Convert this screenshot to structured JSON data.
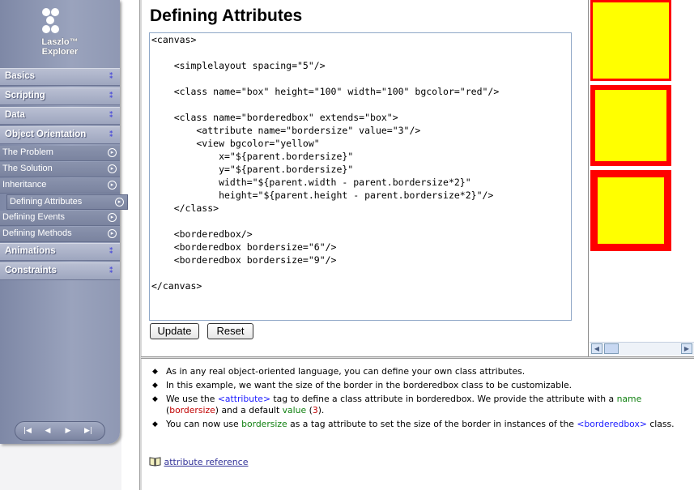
{
  "logo": {
    "line1": "Laszlo™",
    "line2": "Explorer"
  },
  "nav": {
    "main_items": [
      {
        "label": "Basics"
      },
      {
        "label": "Scripting"
      },
      {
        "label": "Data"
      },
      {
        "label": "Object Orientation"
      }
    ],
    "sub_items": [
      {
        "label": "The Problem"
      },
      {
        "label": "The Solution"
      },
      {
        "label": "Inheritance"
      },
      {
        "label": "Defining Attributes"
      },
      {
        "label": "Defining Events"
      },
      {
        "label": "Defining Methods"
      }
    ],
    "bottom_items": [
      {
        "label": "Animations"
      },
      {
        "label": "Constraints"
      }
    ],
    "active_item": "Defining Attributes",
    "player_buttons": [
      "first-icon",
      "prev-icon",
      "next-icon",
      "last-icon"
    ]
  },
  "page": {
    "title": "Defining Attributes"
  },
  "code": "<canvas>\n\n    <simplelayout spacing=\"5\"/>\n\n    <class name=\"box\" height=\"100\" width=\"100\" bgcolor=\"red\"/>\n\n    <class name=\"borderedbox\" extends=\"box\">\n        <attribute name=\"bordersize\" value=\"3\"/>\n        <view bgcolor=\"yellow\"\n            x=\"${parent.bordersize}\"\n            y=\"${parent.bordersize}\"\n            width=\"${parent.width - parent.bordersize*2}\"\n            height=\"${parent.height - parent.bordersize*2}\"/>\n    </class>\n\n    <borderedbox/>\n    <borderedbox bordersize=\"6\"/>\n    <borderedbox bordersize=\"9\"/>\n\n</canvas>",
  "buttons": {
    "update": "Update",
    "reset": "Reset"
  },
  "preview": {
    "border_sizes": [
      3,
      6,
      9
    ],
    "outer_color": "#ff0000",
    "inner_color": "#ffff00"
  },
  "notes": {
    "n1": "As in any real object-oriented language, you can define your own class attributes.",
    "n2": "In this example, we want the size of the border in the borderedbox class to be customizable.",
    "n3_a": "We use the ",
    "n3_tag": "<attribute>",
    "n3_b": " tag to define a class attribute in borderedbox. We provide the attribute with a ",
    "n3_name": "name",
    "n3_c": " (",
    "n3_bordersize": "bordersize",
    "n3_d": ") and a default ",
    "n3_value": "value",
    "n3_e": " (",
    "n3_three": "3",
    "n3_f": ").",
    "n4_a": "You can now use ",
    "n4_bordersize": "bordersize",
    "n4_b": " as a tag attribute to set the size of the border in instances of the ",
    "n4_tag": "<borderedbox>",
    "n4_c": " class."
  },
  "reference": {
    "link": "attribute reference"
  }
}
